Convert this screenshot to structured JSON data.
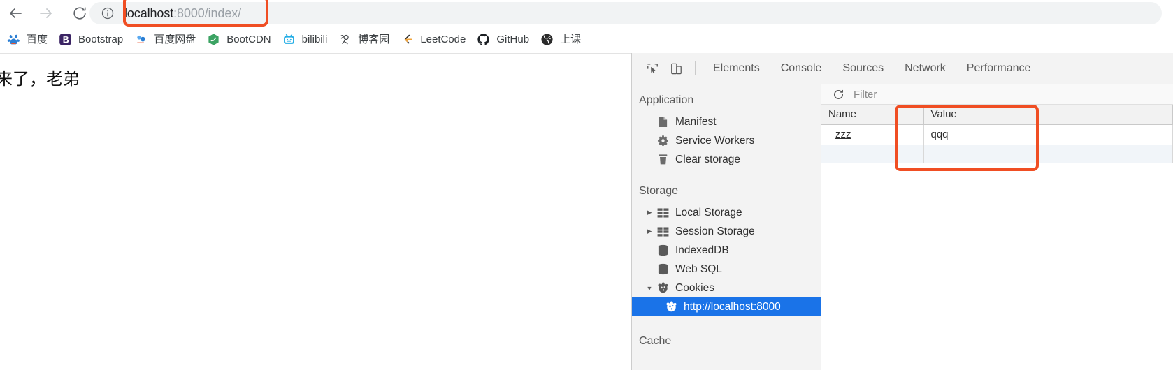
{
  "browser": {
    "nav": {
      "back_label": "Back",
      "forward_label": "Forward",
      "reload_label": "Reload"
    },
    "omnibox": {
      "security_icon": "info-circle-icon",
      "url_host": "localhost",
      "url_rest": ":8000/index/",
      "full_url": "localhost:8000/index/"
    },
    "bookmarks": [
      {
        "label": "百度",
        "icon": "baidu-paw-icon"
      },
      {
        "label": "Bootstrap",
        "icon": "bootstrap-b-icon"
      },
      {
        "label": "百度网盘",
        "icon": "baidu-pan-cloud-icon"
      },
      {
        "label": "BootCDN",
        "icon": "bootcdn-hexagon-icon"
      },
      {
        "label": "bilibili",
        "icon": "bilibili-tv-icon"
      },
      {
        "label": "博客园",
        "icon": "cnblogs-icon"
      },
      {
        "label": "LeetCode",
        "icon": "leetcode-icon"
      },
      {
        "label": "GitHub",
        "icon": "github-cat-icon"
      },
      {
        "label": "上课",
        "icon": "globe-icon"
      }
    ]
  },
  "page": {
    "body_text": "来了，老弟"
  },
  "devtools": {
    "toolbar_icons": [
      {
        "name": "inspect-element-icon"
      },
      {
        "name": "device-toolbar-icon"
      }
    ],
    "tabs": [
      {
        "label": "Elements",
        "active": false
      },
      {
        "label": "Console",
        "active": false
      },
      {
        "label": "Sources",
        "active": false
      },
      {
        "label": "Network",
        "active": false
      },
      {
        "label": "Performance",
        "active": false
      }
    ],
    "sidebar": {
      "groups": [
        {
          "title": "Application",
          "items": [
            {
              "label": "Manifest",
              "icon": "document-icon",
              "twisty": "none",
              "indent": 1,
              "selected": false
            },
            {
              "label": "Service Workers",
              "icon": "gear-icon",
              "twisty": "none",
              "indent": 1,
              "selected": false
            },
            {
              "label": "Clear storage",
              "icon": "trash-icon",
              "twisty": "none",
              "indent": 1,
              "selected": false
            }
          ]
        },
        {
          "title": "Storage",
          "items": [
            {
              "label": "Local Storage",
              "icon": "table-grid-icon",
              "twisty": "collapsed",
              "indent": 1,
              "selected": false
            },
            {
              "label": "Session Storage",
              "icon": "table-grid-icon",
              "twisty": "collapsed",
              "indent": 1,
              "selected": false
            },
            {
              "label": "IndexedDB",
              "icon": "database-icon",
              "twisty": "none",
              "indent": 1,
              "selected": false
            },
            {
              "label": "Web SQL",
              "icon": "database-icon",
              "twisty": "none",
              "indent": 1,
              "selected": false
            },
            {
              "label": "Cookies",
              "icon": "cookie-icon",
              "twisty": "expanded",
              "indent": 1,
              "selected": false
            },
            {
              "label": "http://localhost:8000",
              "icon": "cookie-icon",
              "twisty": "none",
              "indent": 2,
              "selected": true
            }
          ]
        },
        {
          "title": "Cache",
          "items": []
        }
      ]
    },
    "cookies_panel": {
      "refresh_icon": "refresh-icon",
      "filter_placeholder": "Filter",
      "filter_value": "",
      "columns": [
        "Name",
        "Value"
      ],
      "rows": [
        {
          "Name": "zzz",
          "Value": "qqq"
        }
      ]
    }
  },
  "annotations": {
    "accent_color": "#f04e23",
    "boxes": [
      {
        "name": "url-highlight"
      },
      {
        "name": "cookie-table-highlight"
      }
    ]
  }
}
